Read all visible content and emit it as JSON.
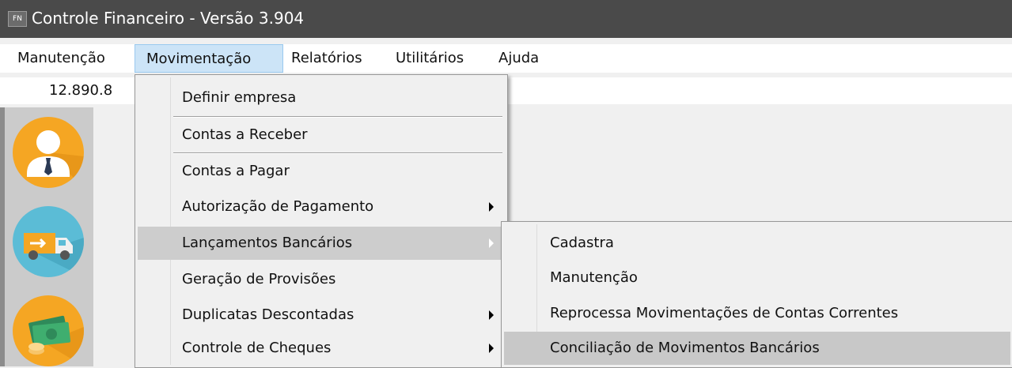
{
  "window": {
    "icon_text": "FN",
    "title": "Controle Financeiro - Versão 3.904"
  },
  "menubar": {
    "items": [
      {
        "label": "Manutenção"
      },
      {
        "label": "Movimentação"
      },
      {
        "label": "Relatórios"
      },
      {
        "label": "Utilitários"
      },
      {
        "label": "Ajuda"
      }
    ]
  },
  "status": {
    "value": "12.890.8"
  },
  "toolbar": {
    "icons": [
      "user-icon",
      "delivery-truck-icon",
      "money-icon"
    ]
  },
  "movimentacao_menu": {
    "items": [
      {
        "label": "Definir empresa"
      },
      {
        "label": "Contas a Receber"
      },
      {
        "label": "Contas a Pagar"
      },
      {
        "label": "Autorização de Pagamento"
      },
      {
        "label": "Lançamentos Bancários"
      },
      {
        "label": "Geração de Provisões"
      },
      {
        "label": "Duplicatas Descontadas"
      },
      {
        "label": "Controle de Cheques"
      }
    ]
  },
  "lancamentos_submenu": {
    "items": [
      {
        "label": "Cadastra"
      },
      {
        "label": "Manutenção"
      },
      {
        "label": "Reprocessa Movimentações de Contas Correntes"
      },
      {
        "label": "Conciliação de Movimentos Bancários"
      }
    ]
  },
  "colors": {
    "titlebar": "#4a4a4a",
    "menu_highlight": "#cdcdcd",
    "accent_orange": "#f5a623",
    "accent_blue": "#5bbcd6"
  }
}
